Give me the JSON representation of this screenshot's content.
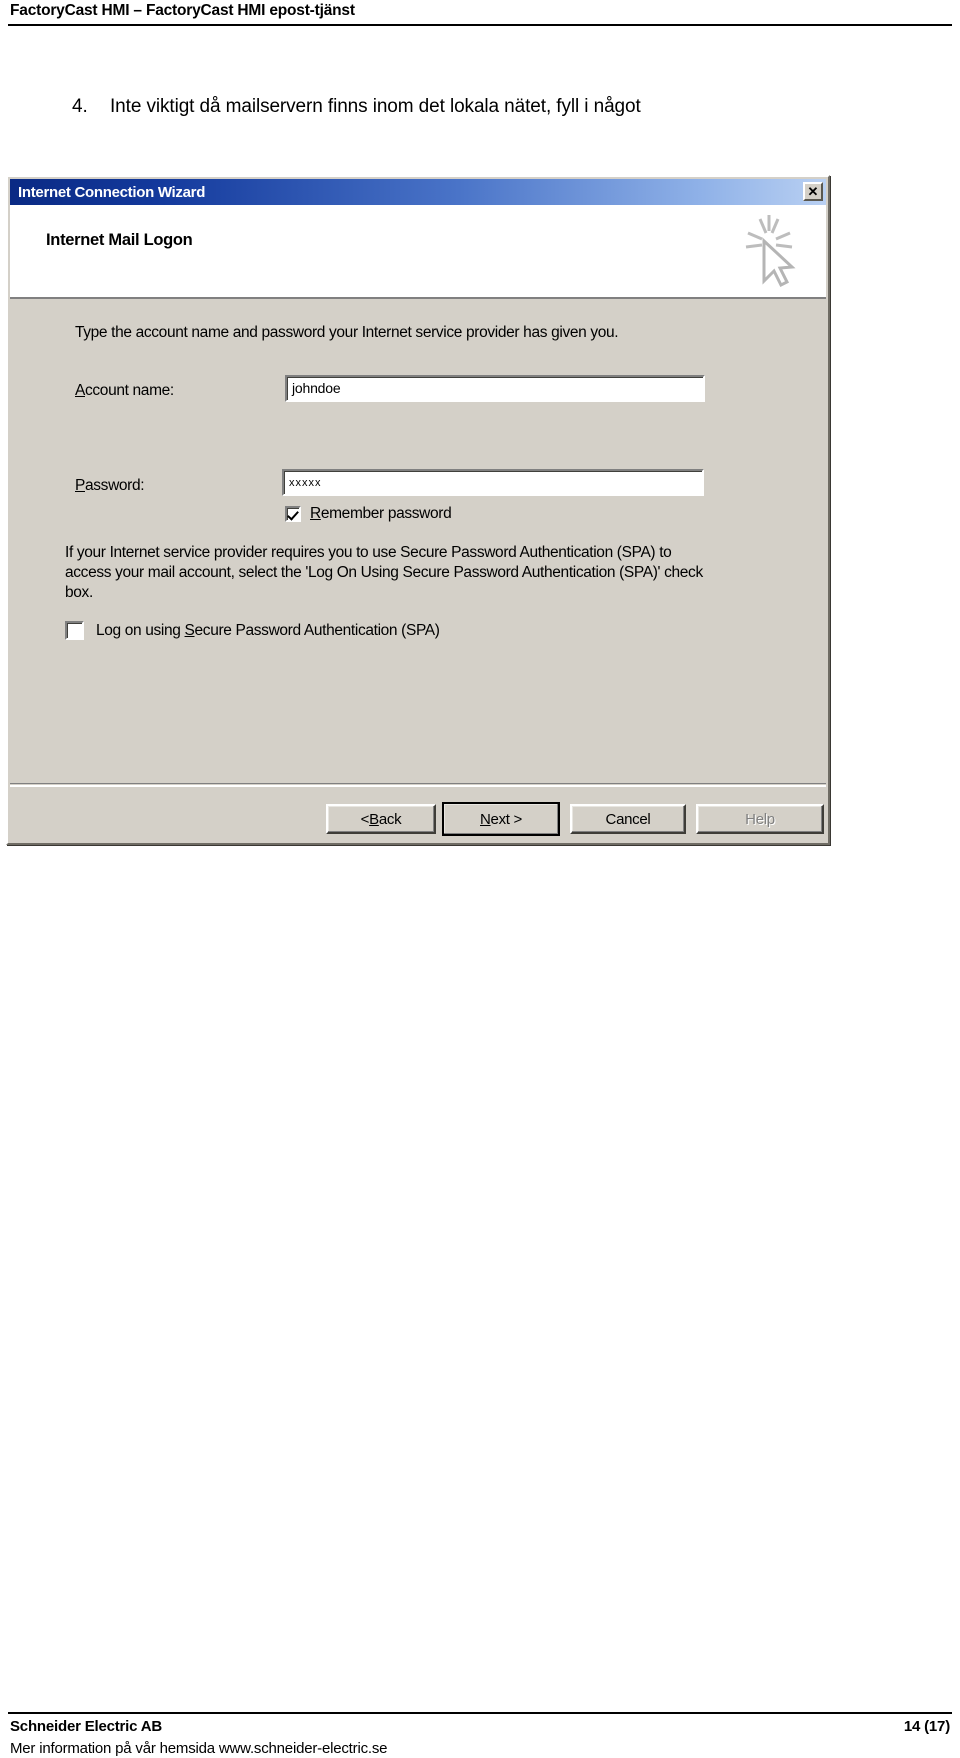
{
  "document": {
    "header_title": "FactoryCast HMI – FactoryCast HMI epost-tjänst",
    "step": {
      "number": "4.",
      "text": "Inte viktigt då mailservern finns inom det lokala nätet, fyll i något"
    },
    "footer": {
      "company": "Schneider Electric AB",
      "info": "Mer information på vår hemsida www.schneider-electric.se",
      "page": "14 (17)"
    }
  },
  "dialog": {
    "title": "Internet Connection Wizard",
    "close_label": "✕",
    "close_icon": "close-icon",
    "banner": {
      "heading": "Internet Mail Logon",
      "icon": "cursor-sparkle-icon"
    },
    "intro": "Type the account name and password your Internet service provider has given you.",
    "fields": {
      "account": {
        "label_prefix": "",
        "label_accel": "A",
        "label_rest": "ccount name:",
        "value": "johndoe",
        "placeholder": ""
      },
      "password": {
        "label_accel": "P",
        "label_rest": "assword:",
        "value": "xxxxx",
        "placeholder": ""
      }
    },
    "checkboxes": {
      "remember": {
        "label_prefix": "",
        "label_accel": "R",
        "label_rest": "emember password",
        "checked": "true"
      },
      "spa": {
        "label_part1": "Log on using ",
        "label_accel": "S",
        "label_part2": "ecure Password Authentication (SPA)",
        "checked": "false"
      }
    },
    "spa_paragraph": "If your Internet service provider requires you to use Secure Password Authentication (SPA) to access your mail account, select the 'Log On Using Secure Password Authentication (SPA)' check box.",
    "buttons": {
      "back_pre": "< ",
      "back_accel": "B",
      "back_rest": "ack",
      "next_accel": "N",
      "next_rest": "ext >",
      "cancel": "Cancel",
      "help": "Help"
    }
  },
  "colors": {
    "dialog_face": "#d4d0c8",
    "titlebar_start": "#0a2a84",
    "titlebar_end": "#b9d0f2",
    "page_bg": "#ffffff",
    "text": "#000000",
    "disabled_text": "#808080"
  }
}
